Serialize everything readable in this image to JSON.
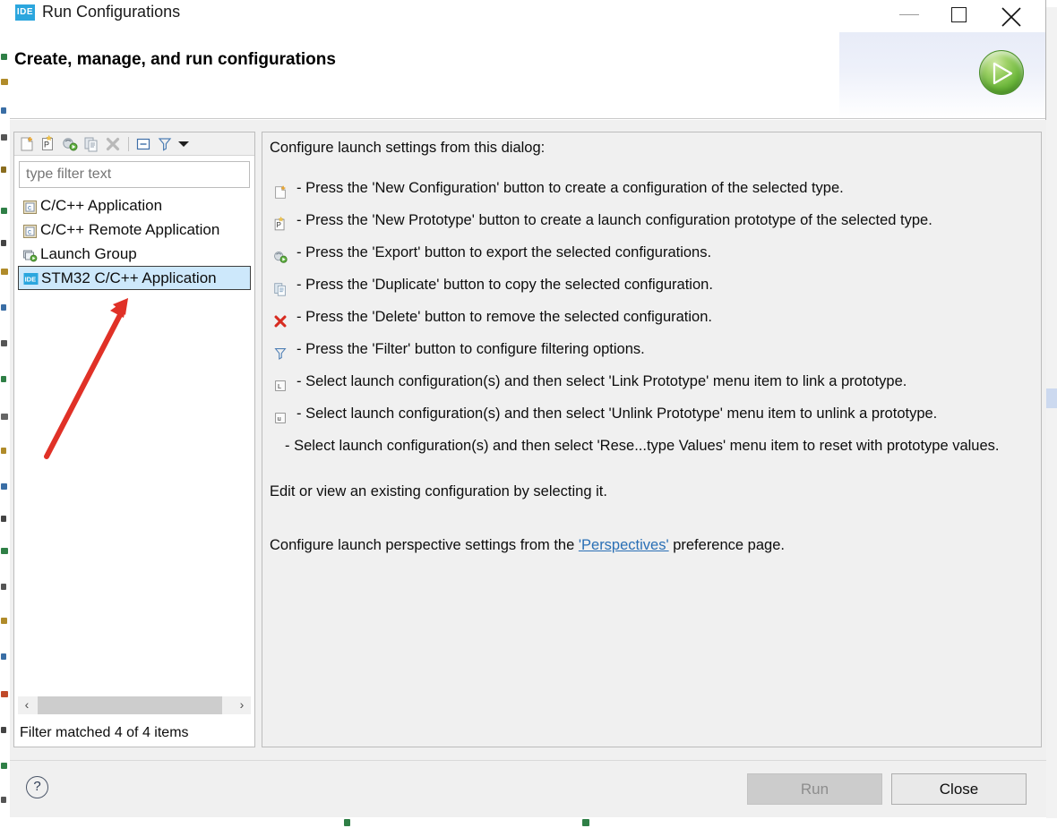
{
  "window": {
    "icon": "ide-icon",
    "title": "Run Configurations",
    "minimize": "minimize-icon",
    "maximize": "maximize-icon",
    "close": "close-icon"
  },
  "header": {
    "title": "Create, manage, and run configurations",
    "run_icon": "run-play-icon"
  },
  "left_panel": {
    "toolbar": [
      {
        "name": "new-configuration-icon",
        "tooltip": "New Configuration"
      },
      {
        "name": "new-prototype-icon",
        "tooltip": "New Prototype"
      },
      {
        "name": "export-icon",
        "tooltip": "Export"
      },
      {
        "name": "duplicate-icon",
        "tooltip": "Duplicate"
      },
      {
        "name": "delete-icon",
        "tooltip": "Delete"
      },
      {
        "name": "collapse-all-icon",
        "tooltip": "Collapse All"
      },
      {
        "name": "filter-icon",
        "tooltip": "Filter"
      },
      {
        "name": "view-menu-caret-icon",
        "tooltip": "View Menu"
      }
    ],
    "filter": {
      "value": "",
      "placeholder": "type filter text"
    },
    "tree": [
      {
        "label": "C/C++ Application",
        "icon": "c-file-icon",
        "selected": false
      },
      {
        "label": "C/C++ Remote Application",
        "icon": "c-file-icon",
        "selected": false
      },
      {
        "label": "Launch Group",
        "icon": "launch-group-icon",
        "selected": false
      },
      {
        "label": "STM32 C/C++ Application",
        "icon": "ide-icon",
        "selected": true
      }
    ],
    "scroll": {
      "left_arrow": "‹",
      "right_arrow": "›"
    },
    "status": "Filter matched 4 of 4 items"
  },
  "right_panel": {
    "intro": "Configure launch settings from this dialog:",
    "items": [
      {
        "icon": "new-configuration-icon",
        "text": "- Press the 'New Configuration' button to create a configuration of the selected type."
      },
      {
        "icon": "new-prototype-icon",
        "text": "- Press the 'New Prototype' button to create a launch configuration prototype of the selected type."
      },
      {
        "icon": "export-icon",
        "text": "- Press the 'Export' button to export the selected configurations."
      },
      {
        "icon": "duplicate-icon",
        "text": "- Press the 'Duplicate' button to copy the selected configuration."
      },
      {
        "icon": "delete-icon",
        "text": "- Press the 'Delete' button to remove the selected configuration."
      },
      {
        "icon": "filter-icon",
        "text": "- Press the 'Filter' button to configure filtering options."
      },
      {
        "icon": "link-prototype-icon",
        "text": "- Select launch configuration(s) and then select 'Link Prototype' menu item to link a prototype."
      },
      {
        "icon": "unlink-prototype-icon",
        "text": "- Select launch configuration(s) and then select 'Unlink Prototype' menu item to unlink a prototype."
      },
      {
        "icon": "none",
        "text": "- Select launch configuration(s) and then select 'Rese...type Values' menu item to reset with prototype values."
      }
    ],
    "edit_note": "Edit or view an existing configuration by selecting it.",
    "perspective_prefix": "Configure launch perspective settings from the ",
    "perspective_link": "'Perspectives'",
    "perspective_suffix": " preference page."
  },
  "footer": {
    "help": "?",
    "run_label": "Run",
    "close_label": "Close"
  },
  "annotation": {
    "arrow_color": "#e03127"
  }
}
